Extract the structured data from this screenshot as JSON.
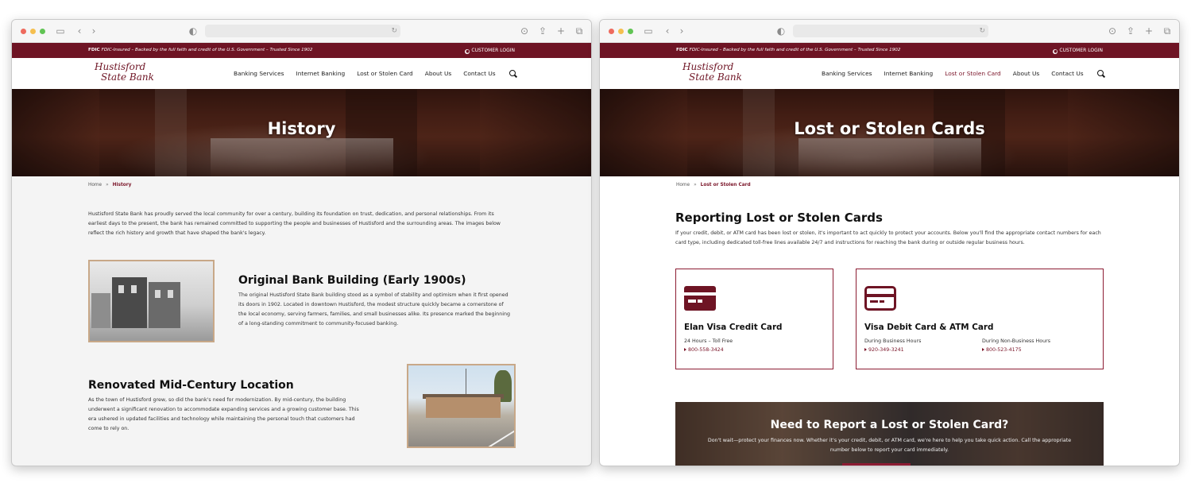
{
  "topbar": {
    "fdic_badge": "FDIC",
    "fdic_text": "FDIC-Insured – Backed by the full faith and credit of the U.S. Government – Trusted Since 1902",
    "login_label": "CUSTOMER LOGIN"
  },
  "logo": {
    "line1": "Hustisford",
    "line2": "State Bank"
  },
  "nav": {
    "items": [
      "Banking Services",
      "Internet Banking",
      "Lost or Stolen Card",
      "About Us",
      "Contact Us"
    ]
  },
  "left": {
    "hero_title": "History",
    "breadcrumb": {
      "home": "Home",
      "sep": "»",
      "current": "History"
    },
    "intro": "Hustisford State Bank has proudly served the local community for over a century, building its foundation on trust, dedication, and personal relationships. From its earliest days to the present, the bank has remained committed to supporting the people and businesses of Hustisford and the surrounding areas. The images below reflect the rich history and growth that have shaped the bank's legacy.",
    "section1": {
      "title": "Original Bank Building (Early 1900s)",
      "text": "The original Hustisford State Bank building stood as a symbol of stability and optimism when it first opened its doors in 1902. Located in downtown Hustisford, the modest structure quickly became a cornerstone of the local economy, serving farmers, families, and small businesses alike. Its presence marked the beginning of a long-standing commitment to community-focused banking."
    },
    "section2": {
      "title": "Renovated Mid-Century Location",
      "text": "As the town of Hustisford grew, so did the bank's need for modernization. By mid-century, the building underwent a significant renovation to accommodate expanding services and a growing customer base. This era ushered in updated facilities and technology while maintaining the personal touch that customers had come to rely on."
    }
  },
  "right": {
    "hero_title": "Lost or Stolen Cards",
    "breadcrumb": {
      "home": "Home",
      "sep": "»",
      "current": "Lost or Stolen Card"
    },
    "heading": "Reporting Lost or Stolen Cards",
    "intro": "If your credit, debit, or ATM card has been lost or stolen, it's important to act quickly to protect your accounts. Below you'll find the appropriate contact numbers for each card type, including dedicated toll-free lines available 24/7 and instructions for reaching the bank during or outside regular business hours.",
    "card_a": {
      "title": "Elan Visa Credit Card",
      "sub": "24 Hours – Toll Free",
      "phone": "800-558-3424"
    },
    "card_b": {
      "title": "Visa Debit Card & ATM Card",
      "sub1": "During Business Hours",
      "phone1": "920-349-3241",
      "sub2": "During Non-Business Hours",
      "phone2": "800-523-4175"
    },
    "cta": {
      "title": "Need to Report a Lost or Stolen Card?",
      "text": "Don't wait—protect your finances now. Whether it's your credit, debit, or ATM card, we're here to help you take quick action. Call the appropriate number below to report your card immediately."
    }
  },
  "colors": {
    "brand": "#6e1424",
    "accent": "#7a1428"
  }
}
